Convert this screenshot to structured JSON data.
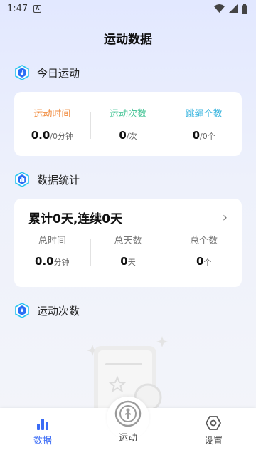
{
  "status_bar": {
    "time": "1:47",
    "notif_icon": "a-icon"
  },
  "page": {
    "title": "运动数据"
  },
  "today": {
    "section_title": "今日运动",
    "stats": [
      {
        "title": "运动时间",
        "value": "0.0",
        "unit": "/0分钟",
        "color": "#f08a3c"
      },
      {
        "title": "运动次数",
        "value": "0",
        "unit": "/次",
        "color": "#4cc79a"
      },
      {
        "title": "跳绳个数",
        "value": "0",
        "unit": "/0个",
        "color": "#3fb7e0"
      }
    ]
  },
  "stats": {
    "section_title": "数据统计",
    "summary": "累计0天,连续0天",
    "items": [
      {
        "title": "总时间",
        "value": "0.0",
        "unit": "分钟"
      },
      {
        "title": "总天数",
        "value": "0",
        "unit": "天"
      },
      {
        "title": "总个数",
        "value": "0",
        "unit": "个"
      }
    ]
  },
  "count": {
    "section_title": "运动次数"
  },
  "tabbar": {
    "tabs": [
      {
        "label": "数据",
        "icon": "bar-chart-icon",
        "active": true
      },
      {
        "label": "运动",
        "icon": "rope-icon",
        "active": false
      },
      {
        "label": "设置",
        "icon": "settings-icon",
        "active": false
      }
    ]
  },
  "colors": {
    "accent": "#3b6cf6",
    "hex_icon": "#27c4f0"
  }
}
